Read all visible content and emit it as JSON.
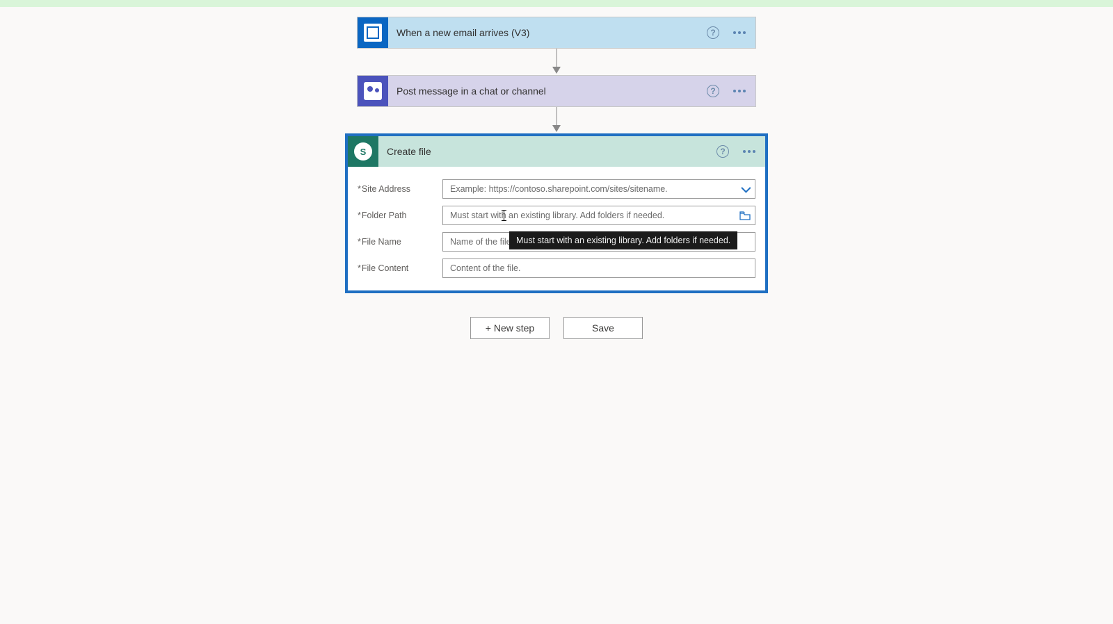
{
  "steps": {
    "trigger": {
      "title": "When a new email arrives (V3)"
    },
    "action1": {
      "title": "Post message in a chat or channel"
    },
    "action2": {
      "title": "Create file",
      "fields": {
        "site_address": {
          "label": "Site Address",
          "placeholder": "Example: https://contoso.sharepoint.com/sites/sitename."
        },
        "folder_path": {
          "label": "Folder Path",
          "placeholder": "Must start with an existing library. Add folders if needed."
        },
        "file_name": {
          "label": "File Name",
          "placeholder": "Name of the file."
        },
        "file_content": {
          "label": "File Content",
          "placeholder": "Content of the file."
        }
      }
    }
  },
  "tooltip": "Must start with an existing library. Add folders if needed.",
  "buttons": {
    "new_step": "+ New step",
    "save": "Save"
  },
  "glyphs": {
    "help": "?"
  }
}
